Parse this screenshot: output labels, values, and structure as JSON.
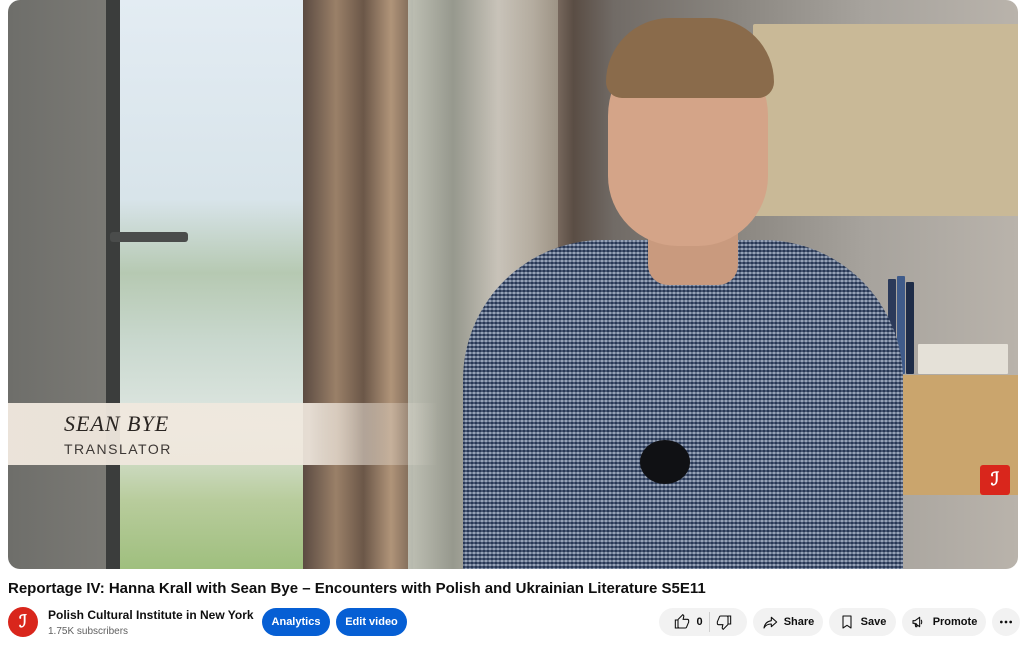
{
  "video": {
    "lower_third": {
      "name": "SEAN BYE",
      "role": "TRANSLATOR"
    },
    "watermark_logo": "institute-logo-icon"
  },
  "title": "Reportage IV: Hanna Krall with Sean Bye – Encounters with Polish and Ukrainian Literature S5E11",
  "channel": {
    "name": "Polish Cultural Institute in New York",
    "subscribers": "1.75K subscribers",
    "avatar_icon": "channel-logo-icon"
  },
  "actions": {
    "analytics": "Analytics",
    "edit_video": "Edit video",
    "like_count": "0",
    "share": "Share",
    "save": "Save",
    "promote": "Promote"
  },
  "colors": {
    "accent_blue": "#065fd4",
    "brand_red": "#d9261c",
    "pill_bg": "#f2f2f2"
  }
}
